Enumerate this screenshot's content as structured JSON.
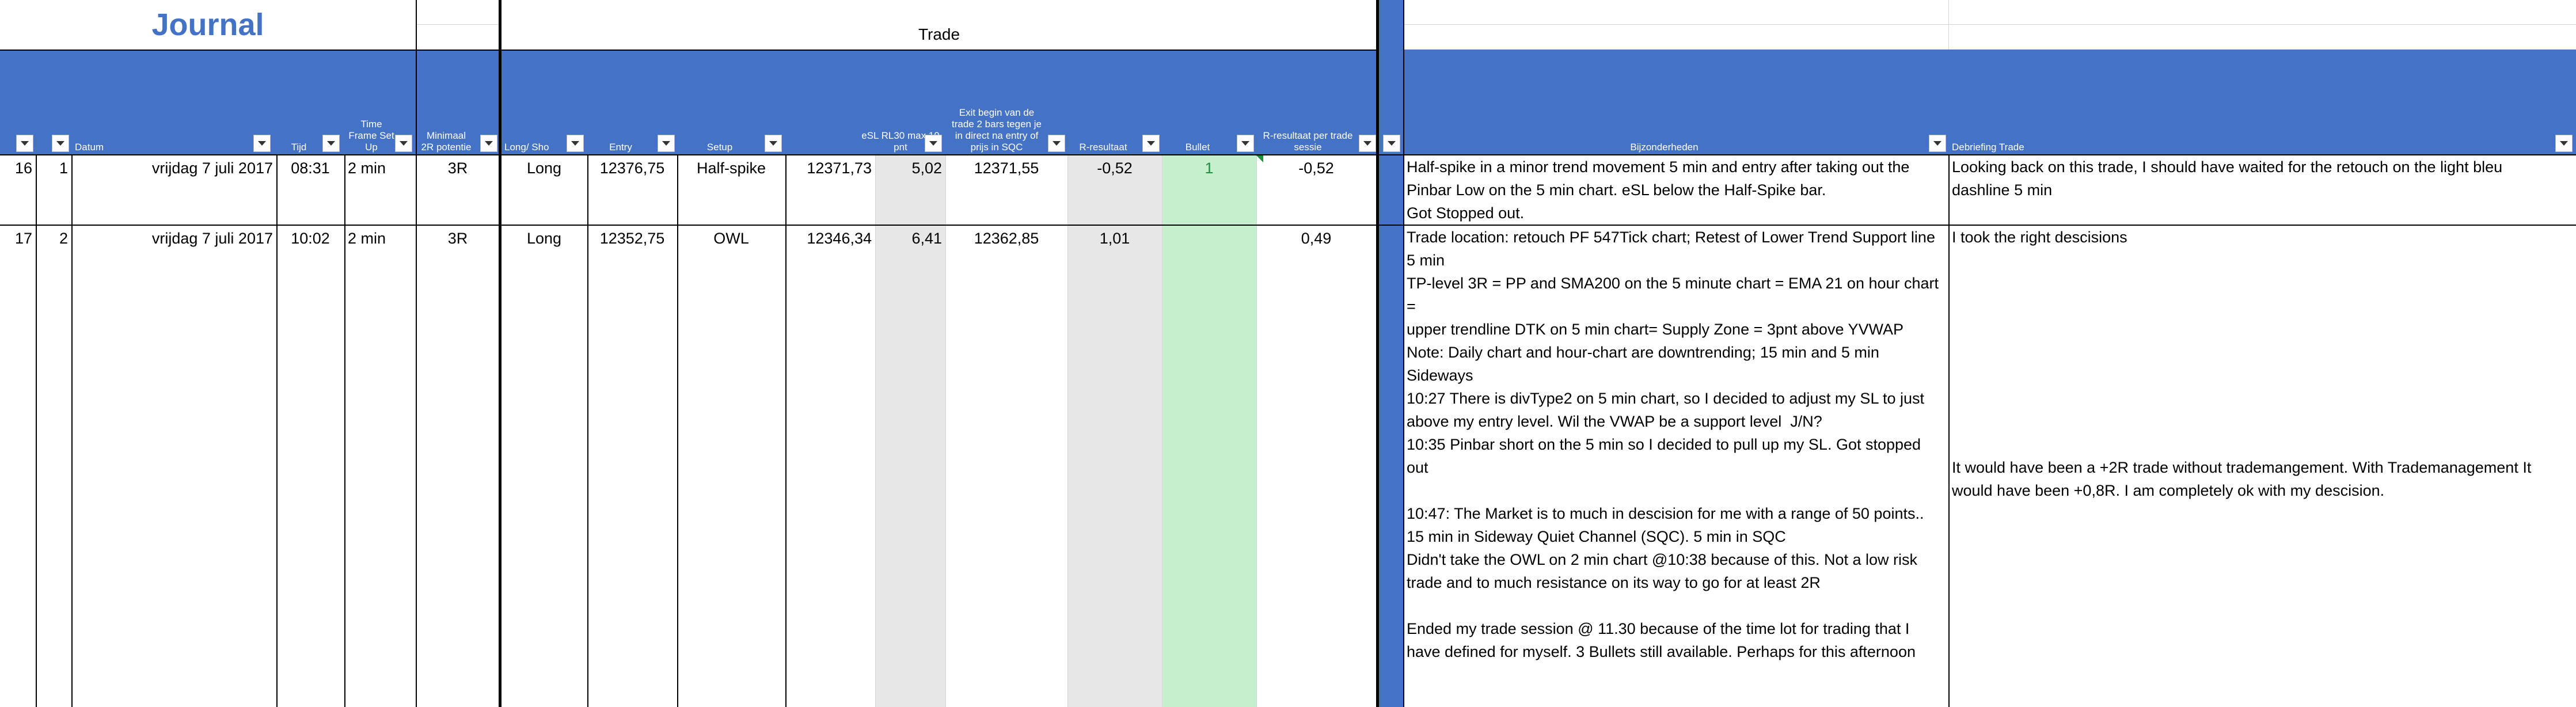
{
  "title": "Journal",
  "section_title": "Trade",
  "columns": {
    "nr": "",
    "id": "",
    "datum": "Datum",
    "tijd": "Tijd",
    "timeframe": "Time Frame Set Up",
    "minimaal": "Minimaal 2R potentie",
    "longshort": "Long/ Sho",
    "entry": "Entry",
    "setup": "Setup",
    "esl": "eSL RL30 max 10 pnt",
    "exit": "Exit begin van de trade 2 bars tegen je in direct na entry of prijs in SQC",
    "rresultaat": "R-resultaat",
    "bullet": "Bullet",
    "rsessie": "R-resultaat per trade sessie",
    "bijzonderheden": "Bijzonderheden",
    "debriefing": "Debriefing Trade"
  },
  "rows": [
    {
      "nr": "16",
      "id": "1",
      "datum": "vrijdag 7 juli 2017",
      "tijd": "08:31",
      "timeframe": "2 min",
      "minimaal": "3R",
      "longshort": "Long",
      "entry": "12376,75",
      "setup": "Half-spike",
      "esl": "12371,73",
      "eslpnt": "5,02",
      "exit": "12371,55",
      "rresultaat": "-0,52",
      "bullet": "1",
      "rsessie": "-0,52",
      "bijzonderheden": "Half-spike in a minor trend movement 5 min and entry after taking out the\nPinbar Low on the 5 min chart. eSL below the Half-Spike bar.\nGot Stopped out.",
      "debriefing": "Looking back on this trade, I should have waited for the retouch on the light bleu\ndashline 5 min"
    },
    {
      "nr": "17",
      "id": "2",
      "datum": "vrijdag 7 juli 2017",
      "tijd": "10:02",
      "timeframe": "2 min",
      "minimaal": "3R",
      "longshort": "Long",
      "entry": "12352,75",
      "setup": "OWL",
      "esl": "12346,34",
      "eslpnt": "6,41",
      "exit": "12362,85",
      "rresultaat": "1,01",
      "bullet": "",
      "rsessie": "0,49",
      "bijzonderheden": "Trade location: retouch PF 547Tick chart; Retest of Lower Trend Support line\n5 min\nTP-level 3R = PP and SMA200 on the 5 minute chart = EMA 21 on hour chart =\nupper trendline DTK on 5 min chart= Supply Zone = 3pnt above YVWAP\nNote: Daily chart and hour-chart are downtrending; 15 min and 5 min\nSideways\n10:27 There is divType2 on 5 min chart, so I decided to adjust my SL to just\nabove my entry level. Wil the VWAP be a support level  J/N?\n10:35 Pinbar short on the 5 min so I decided to pull up my SL. Got stopped\nout\n\n10:47: The Market is to much in descision for me with a range of 50 points..\n15 min in Sideway Quiet Channel (SQC). 5 min in SQC\nDidn't take the OWL on 2 min chart @10:38 because of this. Not a low risk\ntrade and to much resistance on its way to go for at least 2R\n\nEnded my trade session @ 11.30 because of the time lot for trading that I\nhave defined for myself. 3 Bullets still available. Perhaps for this afternoon",
      "debriefing_top": "I took the right descisions",
      "debriefing_bottom": "It would have been a +2R trade without trademangement. With Trademanagement It\nwould have been +0,8R. I am completely ok with my descision."
    }
  ],
  "colors": {
    "header_blue": "#4472c4",
    "title_blue": "#4472c4",
    "grey_fill": "#e7e7e7",
    "green_fill": "#c6efce",
    "bullet_text": "#1e8f3a"
  }
}
